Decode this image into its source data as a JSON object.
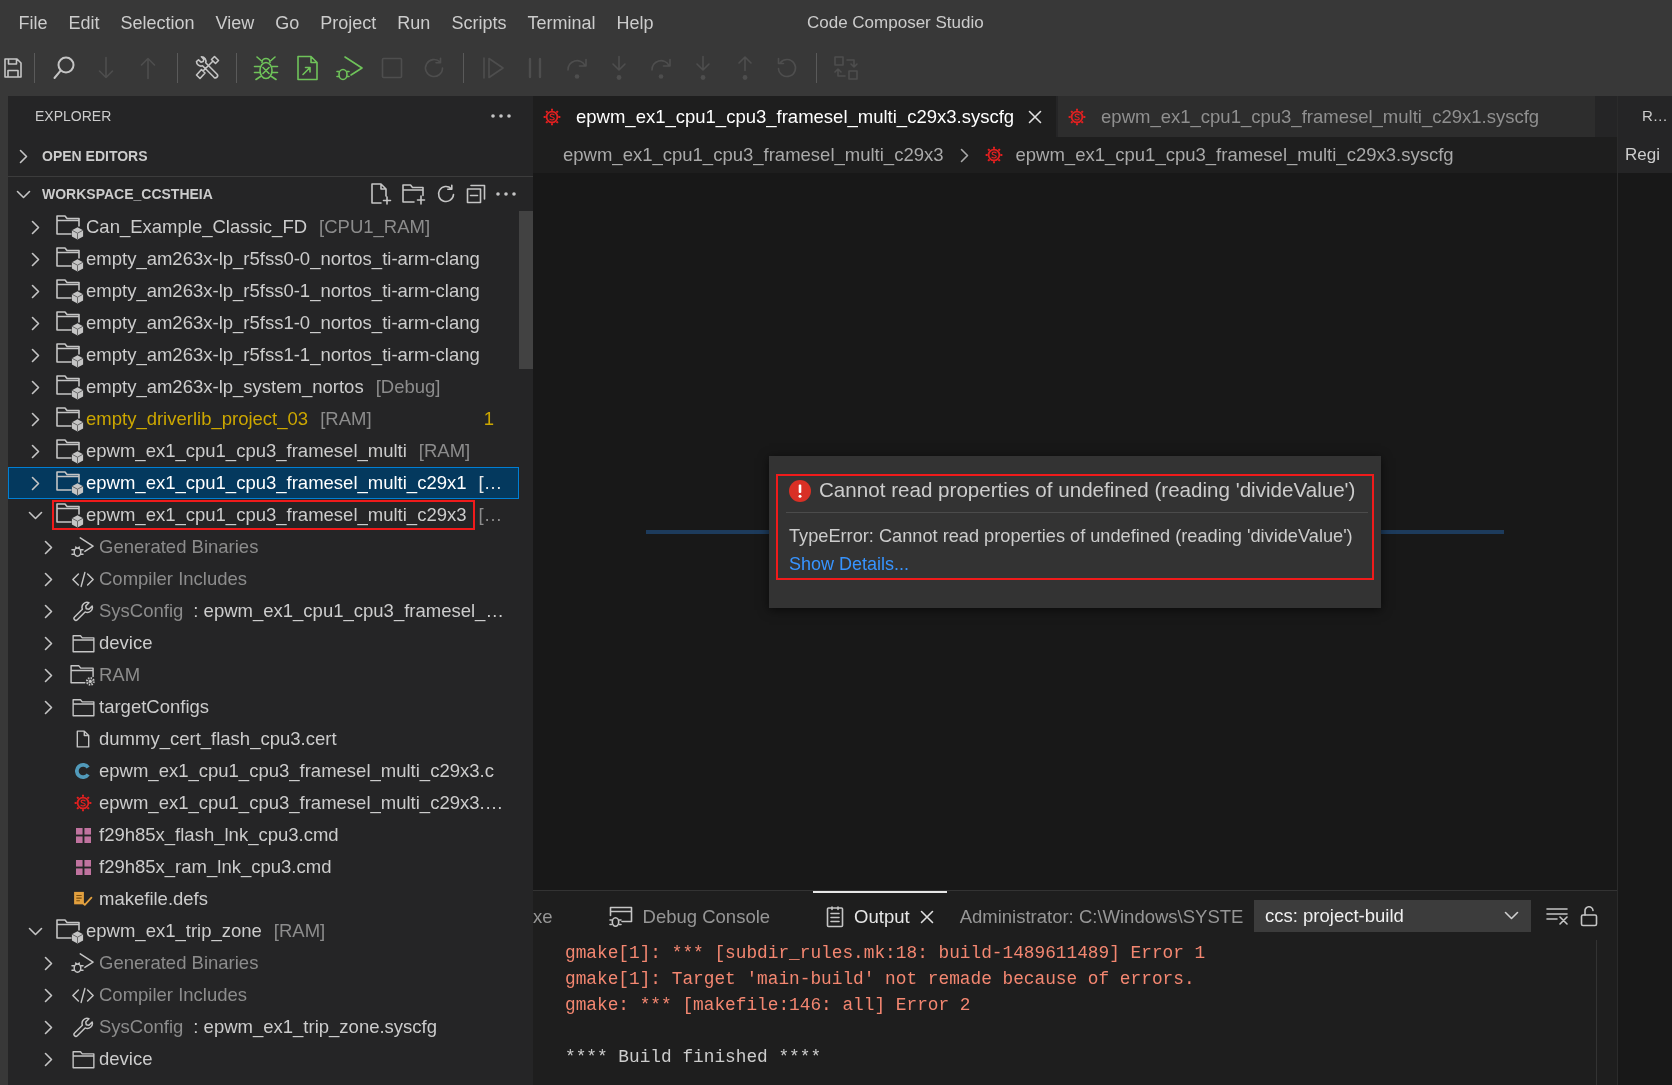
{
  "menu_bar": {
    "items": [
      "File",
      "Edit",
      "Selection",
      "View",
      "Go",
      "Project",
      "Run",
      "Scripts",
      "Terminal",
      "Help"
    ],
    "title": "Code Composer Studio"
  },
  "toolbar": [
    {
      "kind": "save",
      "disabled": false
    },
    {
      "kind": "separator"
    },
    {
      "kind": "search",
      "disabled": false
    },
    {
      "kind": "down",
      "disabled": true
    },
    {
      "kind": "up",
      "disabled": true
    },
    {
      "kind": "separator"
    },
    {
      "kind": "tools",
      "disabled": false
    },
    {
      "kind": "separator"
    },
    {
      "kind": "debug",
      "disabled": false
    },
    {
      "kind": "flash",
      "disabled": false
    },
    {
      "kind": "run",
      "disabled": false
    },
    {
      "kind": "stop",
      "disabled": true
    },
    {
      "kind": "reload",
      "disabled": true
    },
    {
      "kind": "separator"
    },
    {
      "kind": "resume",
      "disabled": true
    },
    {
      "kind": "pause",
      "disabled": true
    },
    {
      "kind": "step-over",
      "disabled": true
    },
    {
      "kind": "step-into",
      "disabled": true
    },
    {
      "kind": "step-over",
      "disabled": true
    },
    {
      "kind": "step-into",
      "disabled": true
    },
    {
      "kind": "step-out",
      "disabled": true
    },
    {
      "kind": "restart",
      "disabled": true
    },
    {
      "kind": "separator"
    },
    {
      "kind": "connect",
      "disabled": true
    }
  ],
  "sidebar": {
    "title": "EXPLORER",
    "sections": [
      {
        "title": "OPEN EDITORS",
        "expanded": false
      },
      {
        "title": "WORKSPACE_CCSTHEIA",
        "expanded": true,
        "tree": [
          {
            "label": "Can_Example_Classic_FD",
            "config": "[CPU1_RAM]",
            "kind": "project",
            "expanded": false,
            "selected": false,
            "warning": false,
            "annotated": false
          },
          {
            "label": "empty_am263x-lp_r5fss0-0_nortos_ti-arm-clang",
            "kind": "project",
            "expanded": false,
            "selected": false,
            "warning": false,
            "annotated": false
          },
          {
            "label": "empty_am263x-lp_r5fss0-1_nortos_ti-arm-clang",
            "kind": "project",
            "expanded": false,
            "selected": false,
            "warning": false,
            "annotated": false
          },
          {
            "label": "empty_am263x-lp_r5fss1-0_nortos_ti-arm-clang",
            "kind": "project",
            "expanded": false,
            "selected": false,
            "warning": false,
            "annotated": false
          },
          {
            "label": "empty_am263x-lp_r5fss1-1_nortos_ti-arm-clang",
            "kind": "project",
            "expanded": false,
            "selected": false,
            "warning": false,
            "annotated": false
          },
          {
            "label": "empty_am263x-lp_system_nortos",
            "config": "[Debug]",
            "kind": "project",
            "expanded": false,
            "selected": false,
            "warning": false,
            "annotated": false
          },
          {
            "label": "empty_driverlib_project_03",
            "config": "[RAM]",
            "badge": "1",
            "kind": "project",
            "expanded": false,
            "selected": false,
            "warning": true,
            "annotated": false
          },
          {
            "label": "epwm_ex1_cpu1_cpu3_framesel_multi",
            "config": "[RAM]",
            "kind": "project",
            "expanded": false,
            "selected": false,
            "warning": false,
            "annotated": false
          },
          {
            "label": "epwm_ex1_cpu1_cpu3_framesel_multi_c29x1",
            "config": "[…",
            "kind": "project",
            "expanded": false,
            "selected": true,
            "warning": false,
            "annotated": false
          },
          {
            "label": "epwm_ex1_cpu1_cpu3_framesel_multi_c29x3",
            "config": "[…",
            "kind": "project",
            "expanded": true,
            "selected": false,
            "warning": false,
            "annotated": true,
            "children": [
              {
                "label": "Generated Binaries",
                "kind": "binaries",
                "expanded": false,
                "selected": false
              },
              {
                "label": "Compiler Includes",
                "kind": "includes",
                "expanded": false,
                "selected": false
              },
              {
                "label": "SysConfig",
                "detail": ": epwm_ex1_cpu1_cpu3_framesel_…",
                "kind": "sysconfig",
                "expanded": false,
                "selected": false
              },
              {
                "label": "device",
                "kind": "folder",
                "expanded": false,
                "selected": false
              },
              {
                "label": "RAM",
                "kind": "build-folder",
                "expanded": false,
                "selected": false
              },
              {
                "label": "targetConfigs",
                "kind": "folder",
                "expanded": false,
                "selected": false
              },
              {
                "label": "dummy_cert_flash_cpu3.cert",
                "kind": "file",
                "selected": false
              },
              {
                "label": "epwm_ex1_cpu1_cpu3_framesel_multi_c29x3.c",
                "kind": "c-source",
                "selected": false
              },
              {
                "label": "epwm_ex1_cpu1_cpu3_framesel_multi_c29x3.…",
                "kind": "syscfg",
                "selected": false
              },
              {
                "label": "f29h85x_flash_lnk_cpu3.cmd",
                "kind": "linker-cmd",
                "selected": false
              },
              {
                "label": "f29h85x_ram_lnk_cpu3.cmd",
                "kind": "linker-cmd",
                "selected": false
              },
              {
                "label": "makefile.defs",
                "kind": "makefile",
                "selected": false
              }
            ]
          },
          {
            "label": "epwm_ex1_trip_zone",
            "config": "[RAM]",
            "kind": "project",
            "expanded": true,
            "selected": false,
            "warning": false,
            "annotated": false,
            "children": [
              {
                "label": "Generated Binaries",
                "kind": "binaries",
                "expanded": false,
                "selected": false
              },
              {
                "label": "Compiler Includes",
                "kind": "includes",
                "expanded": false,
                "selected": false
              },
              {
                "label": "SysConfig",
                "detail": ": epwm_ex1_trip_zone.syscfg",
                "kind": "sysconfig",
                "expanded": false,
                "selected": false
              },
              {
                "label": "device",
                "kind": "folder",
                "expanded": false,
                "selected": false
              }
            ]
          }
        ]
      }
    ]
  },
  "editor": {
    "tabs": [
      {
        "label": "epwm_ex1_cpu1_cpu3_framesel_multi_c29x3.syscfg",
        "selected": true
      },
      {
        "label": "epwm_ex1_cpu1_cpu3_framesel_multi_c29x1.syscfg",
        "selected": false
      }
    ],
    "breadcrumb": [
      {
        "label": "epwm_ex1_cpu1_cpu3_framesel_multi_c29x3",
        "kind": "folder"
      },
      {
        "label": "epwm_ex1_cpu1_cpu3_framesel_multi_c29x3.syscfg",
        "kind": "syscfg"
      }
    ],
    "dialog": {
      "title": "Cannot read properties of undefined (reading 'divideValue')",
      "message": "TypeError: Cannot read properties of undefined (reading 'divideValue')",
      "link": "Show Details...",
      "annotated": true
    }
  },
  "side_panel": {
    "tab": "R…",
    "title": "Regi"
  },
  "bottom_panel": {
    "tabs": [
      {
        "label": "xe",
        "kind": "cut",
        "selected": false
      },
      {
        "label": "Debug Console",
        "kind": "debug-console",
        "selected": false
      },
      {
        "label": "Output",
        "kind": "output",
        "selected": true
      },
      {
        "label": "Administrator: C:\\Windows\\SYSTE",
        "kind": "terminal",
        "selected": false
      }
    ],
    "channel": "ccs: project-build",
    "output": [
      [
        {
          "text": "gmake[1]: *** [subdir_rules.mk:18: build-1489611489] Error 1",
          "error": true
        },
        {
          "text": "gmake[1]: Target 'main-build' not remade because of errors.",
          "error": true
        },
        {
          "text": "gmake: *** [makefile:146: all] Error 2",
          "error": true
        }
      ],
      [
        {
          "text": "**** Build finished ****",
          "error": false
        }
      ]
    ]
  }
}
